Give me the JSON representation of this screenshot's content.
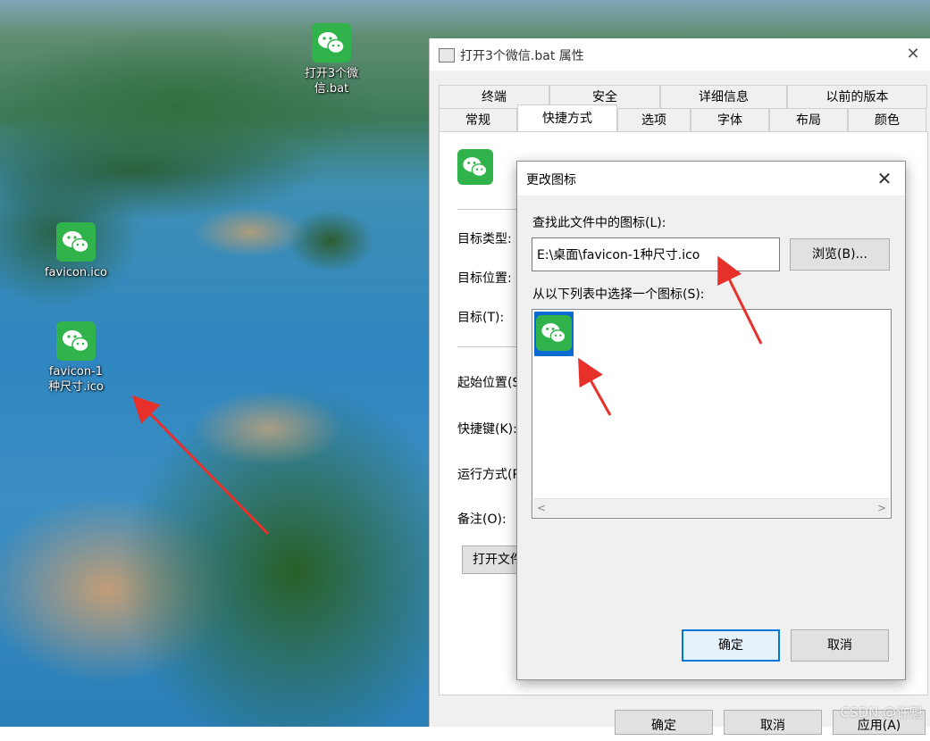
{
  "desktop": {
    "icons": [
      {
        "label": "打开3个微信.bat",
        "icon": "wechat-icon"
      },
      {
        "label": "favicon.ico",
        "icon": "wechat-icon"
      },
      {
        "label": "favicon-1种尺寸.ico",
        "icon": "wechat-icon"
      }
    ]
  },
  "properties": {
    "title": "打开3个微信.bat 属性",
    "tabs_row1": [
      "终端",
      "安全",
      "详细信息",
      "以前的版本"
    ],
    "tabs_row2": [
      "常规",
      "快捷方式",
      "选项",
      "字体",
      "布局",
      "颜色"
    ],
    "active_tab": "快捷方式",
    "labels": {
      "target_type": "目标类型:",
      "target_location": "目标位置:",
      "target": "目标(T):",
      "start_in": "起始位置(S",
      "shortcut_key": "快捷键(K):",
      "run": "运行方式(R",
      "comment": "备注(O):"
    },
    "open_file_button": "打开文件",
    "buttons": {
      "ok": "确定",
      "cancel": "取消",
      "apply": "应用(A)"
    }
  },
  "change_icon": {
    "title": "更改图标",
    "find_label": "查找此文件中的图标(L):",
    "path_value": "E:\\桌面\\favicon-1种尺寸.ico",
    "browse_button": "浏览(B)...",
    "list_label": "从以下列表中选择一个图标(S):",
    "ok_button": "确定",
    "cancel_button": "取消"
  },
  "colors": {
    "wechat_green": "#2fb34a",
    "arrow_red": "#e8302a",
    "selection_blue": "#0a6ad1"
  },
  "watermark": "CSDN @许魁"
}
